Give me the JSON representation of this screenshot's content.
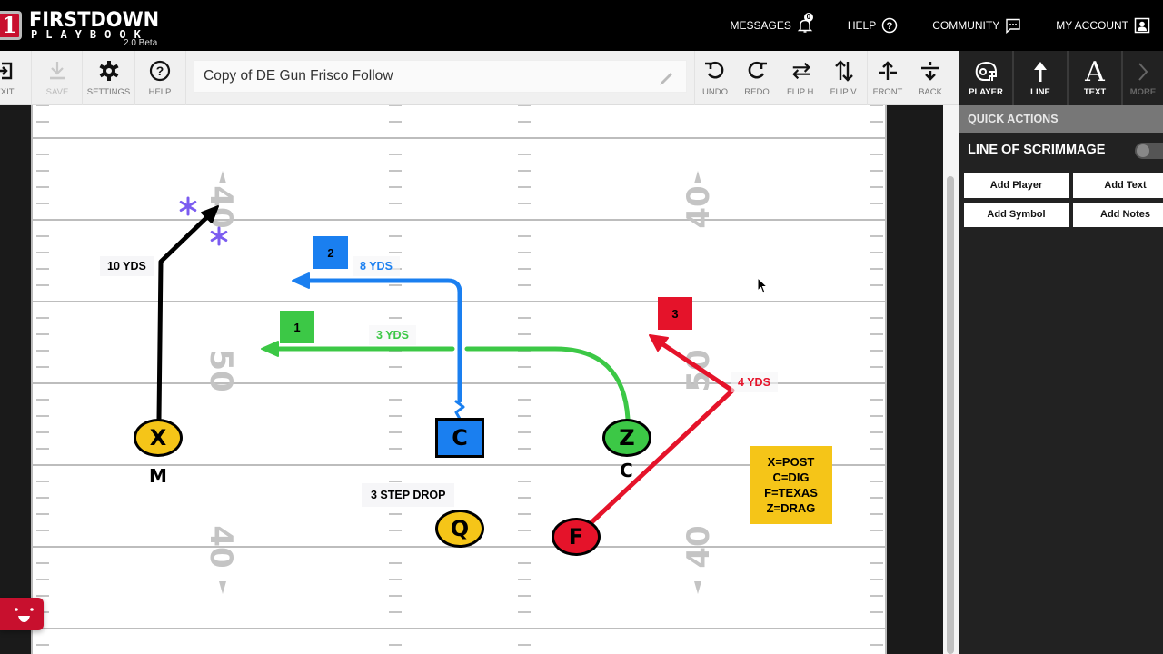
{
  "header": {
    "logo_mark": "1",
    "logo_title": "FIRSTDOWN",
    "logo_subtitle": "PLAYBOOK",
    "logo_tm": "™",
    "version": "2.0 Beta",
    "nav": [
      {
        "label": "MESSAGES",
        "icon": "bell-icon",
        "badge": "0"
      },
      {
        "label": "HELP",
        "icon": "help-circle-icon"
      },
      {
        "label": "COMMUNITY",
        "icon": "chat-icon"
      },
      {
        "label": "MY ACCOUNT",
        "icon": "account-icon"
      }
    ]
  },
  "toolbar": {
    "buttons_left": [
      {
        "label": "EXIT",
        "icon": "exit-icon",
        "enabled": true
      },
      {
        "label": "SAVE",
        "icon": "download-icon",
        "enabled": false
      },
      {
        "label": "SETTINGS",
        "icon": "gear-icon",
        "enabled": true
      },
      {
        "label": "HELP",
        "icon": "help-circle-icon",
        "enabled": true
      }
    ],
    "play_name": "Copy of DE Gun Frisco Follow",
    "buttons_right": [
      {
        "label": "UNDO",
        "icon": "undo-icon"
      },
      {
        "label": "REDO",
        "icon": "redo-icon"
      },
      {
        "label": "FLIP H.",
        "icon": "flip-horizontal-icon"
      },
      {
        "label": "FLIP V.",
        "icon": "flip-vertical-icon"
      },
      {
        "label": "FRONT",
        "icon": "bring-front-icon"
      },
      {
        "label": "BACK",
        "icon": "send-back-icon"
      }
    ]
  },
  "side_toolbar": {
    "buttons": [
      {
        "label": "PLAYER",
        "icon": "helmet-icon"
      },
      {
        "label": "LINE",
        "icon": "arrow-up-icon"
      },
      {
        "label": "TEXT",
        "icon": "text-icon"
      },
      {
        "label": "MORE",
        "icon": "chevron-right-icon"
      }
    ]
  },
  "side_panel": {
    "quick_actions_title": "QUICK ACTIONS",
    "line_of_scrimmage_label": "LINE OF SCRIMMAGE",
    "line_of_scrimmage_on": false,
    "actions": [
      "Add Player",
      "Add Text",
      "Add Symbol",
      "Add Notes"
    ]
  },
  "field": {
    "yard_numbers": [
      "40",
      "50",
      "40"
    ],
    "players": [
      {
        "id": "X",
        "shape": "circle",
        "color": "#f5c518",
        "under_label": "M"
      },
      {
        "id": "C",
        "shape": "square",
        "color": "#1a7ff0"
      },
      {
        "id": "Z",
        "shape": "circle",
        "color": "#3cc846",
        "under_label": "C"
      },
      {
        "id": "Q",
        "shape": "circle",
        "color": "#f5c518"
      },
      {
        "id": "F",
        "shape": "circle",
        "color": "#e5132a"
      }
    ],
    "route_tags": [
      {
        "num": "1",
        "color": "#3cc846"
      },
      {
        "num": "2",
        "color": "#1a7ff0"
      },
      {
        "num": "3",
        "color": "#e5132a"
      }
    ],
    "route_labels": [
      {
        "text": "10 YDS",
        "color": "#000000"
      },
      {
        "text": "8 YDS",
        "color": "#1a7ff0"
      },
      {
        "text": "3 YDS",
        "color": "#3cc846"
      },
      {
        "text": "4 YDS",
        "color": "#e5132a"
      },
      {
        "text": "3 STEP DROP",
        "color": "#000000"
      }
    ],
    "notes": [
      "X=POST",
      "C=DIG",
      "F=TEXAS",
      "Z=DRAG"
    ],
    "symbol_color": "#7b5cf0"
  }
}
